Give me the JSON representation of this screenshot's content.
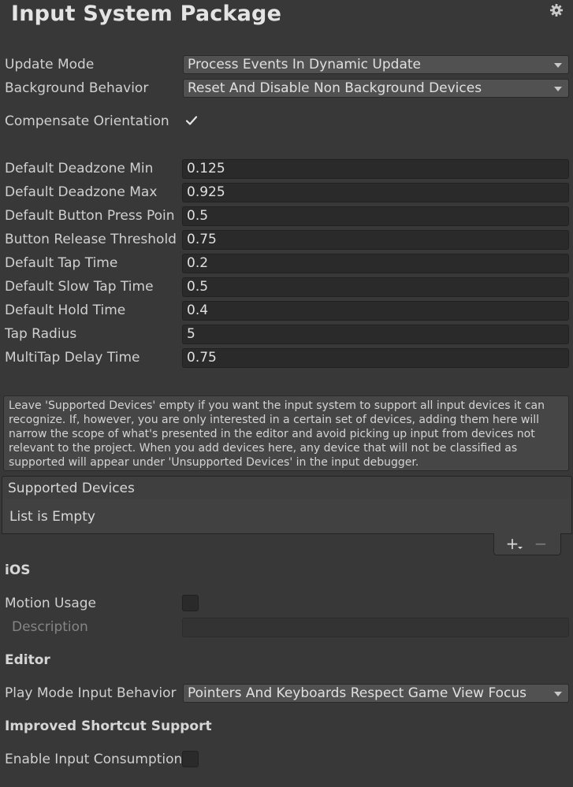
{
  "header": {
    "title": "Input System Package",
    "settings_icon": "gear-icon"
  },
  "general": {
    "update_mode": {
      "label": "Update Mode",
      "value": "Process Events In Dynamic Update"
    },
    "background_behavior": {
      "label": "Background Behavior",
      "value": "Reset And Disable Non Background Devices"
    },
    "compensate_orientation": {
      "label": "Compensate Orientation",
      "checked": true
    }
  },
  "fields": [
    {
      "label": "Default Deadzone Min",
      "value": "0.125"
    },
    {
      "label": "Default Deadzone Max",
      "value": "0.925"
    },
    {
      "label": "Default Button Press Poin",
      "value": "0.5"
    },
    {
      "label": "Button Release Threshold",
      "value": "0.75"
    },
    {
      "label": "Default Tap Time",
      "value": "0.2"
    },
    {
      "label": "Default Slow Tap Time",
      "value": "0.5"
    },
    {
      "label": "Default Hold Time",
      "value": "0.4"
    },
    {
      "label": "Tap Radius",
      "value": "5"
    },
    {
      "label": "MultiTap Delay Time",
      "value": "0.75"
    }
  ],
  "help": {
    "text": "Leave 'Supported Devices' empty if you want the input system to support all input devices it can recognize. If, however, you are only interested in a certain set of devices, adding them here will narrow the scope of what's presented in the editor and avoid picking up input from devices not relevant to the project. When you add devices here, any device that will not be classified as supported will appear under 'Unsupported Devices' in the input debugger."
  },
  "supported_devices": {
    "header": "Supported Devices",
    "empty_text": "List is Empty",
    "add_label": "+",
    "remove_label": "−"
  },
  "ios": {
    "section": "iOS",
    "motion_usage": {
      "label": "Motion Usage",
      "checked": false
    },
    "description": {
      "label": "Description",
      "value": ""
    }
  },
  "editor": {
    "section": "Editor",
    "play_mode": {
      "label": "Play Mode Input Behavior",
      "value": "Pointers And Keyboards Respect Game View Focus"
    }
  },
  "shortcut": {
    "section": "Improved Shortcut Support",
    "enable_input_consumption": {
      "label": "Enable Input Consumption",
      "checked": false
    }
  },
  "colors": {
    "background": "#383838",
    "field": "#2a2a2a",
    "dropdown": "#515151",
    "text": "#d2d2d2"
  }
}
